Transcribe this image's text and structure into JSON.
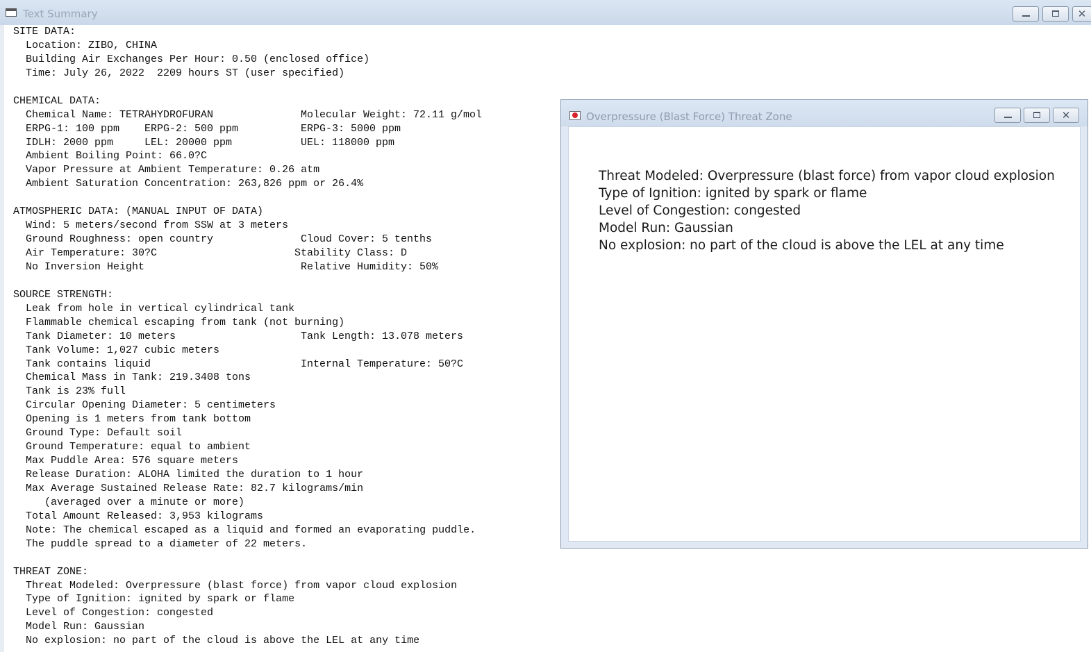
{
  "main_window": {
    "title": "Text Summary",
    "lines": [
      [
        "SITE DATA:",
        ""
      ],
      [
        "  Location: ZIBO, CHINA",
        ""
      ],
      [
        "  Building Air Exchanges Per Hour: 0.50 (enclosed office)",
        ""
      ],
      [
        "  Time: July 26, 2022  2209 hours ST (user specified)",
        ""
      ],
      [
        "",
        ""
      ],
      [
        "CHEMICAL DATA:",
        ""
      ],
      [
        "  Chemical Name: TETRAHYDROFURAN",
        "Molecular Weight: 72.11 g/mol"
      ],
      [
        "  ERPG-1: 100 ppm    ERPG-2: 500 ppm",
        "ERPG-3: 5000 ppm"
      ],
      [
        "  IDLH: 2000 ppm     LEL: 20000 ppm",
        "UEL: 118000 ppm"
      ],
      [
        "  Ambient Boiling Point: 66.0?C",
        ""
      ],
      [
        "  Vapor Pressure at Ambient Temperature: 0.26 atm",
        ""
      ],
      [
        "  Ambient Saturation Concentration: 263,826 ppm or 26.4%",
        ""
      ],
      [
        "",
        ""
      ],
      [
        "ATMOSPHERIC DATA: (MANUAL INPUT OF DATA)",
        ""
      ],
      [
        "  Wind: 5 meters/second from SSW at 3 meters",
        ""
      ],
      [
        "  Ground Roughness: open country",
        "Cloud Cover: 5 tenths"
      ],
      [
        "  Air Temperature: 30?C",
        "Stability Class: D"
      ],
      [
        "  No Inversion Height",
        "Relative Humidity: 50%"
      ],
      [
        "",
        ""
      ],
      [
        "SOURCE STRENGTH:",
        ""
      ],
      [
        "  Leak from hole in vertical cylindrical tank",
        ""
      ],
      [
        "  Flammable chemical escaping from tank (not burning)",
        ""
      ],
      [
        "  Tank Diameter: 10 meters",
        "Tank Length: 13.078 meters"
      ],
      [
        "  Tank Volume: 1,027 cubic meters",
        ""
      ],
      [
        "  Tank contains liquid",
        "Internal Temperature: 50?C"
      ],
      [
        "  Chemical Mass in Tank: 219.3408 tons",
        ""
      ],
      [
        "  Tank is 23% full",
        ""
      ],
      [
        "  Circular Opening Diameter: 5 centimeters",
        ""
      ],
      [
        "  Opening is 1 meters from tank bottom",
        ""
      ],
      [
        "  Ground Type: Default soil",
        ""
      ],
      [
        "  Ground Temperature: equal to ambient",
        ""
      ],
      [
        "  Max Puddle Area: 576 square meters",
        ""
      ],
      [
        "  Release Duration: ALOHA limited the duration to 1 hour",
        ""
      ],
      [
        "  Max Average Sustained Release Rate: 82.7 kilograms/min",
        ""
      ],
      [
        "     (averaged over a minute or more)",
        ""
      ],
      [
        "  Total Amount Released: 3,953 kilograms",
        ""
      ],
      [
        "  Note: The chemical escaped as a liquid and formed an evaporating puddle.",
        ""
      ],
      [
        "  The puddle spread to a diameter of 22 meters.",
        ""
      ],
      [
        "",
        ""
      ],
      [
        "THREAT ZONE:",
        ""
      ],
      [
        "  Threat Modeled: Overpressure (blast force) from vapor cloud explosion",
        ""
      ],
      [
        "  Type of Ignition: ignited by spark or flame",
        ""
      ],
      [
        "  Level of Congestion: congested",
        ""
      ],
      [
        "  Model Run: Gaussian",
        ""
      ],
      [
        "  No explosion: no part of the cloud is above the LEL at any time",
        ""
      ]
    ]
  },
  "threat_window": {
    "title": "Overpressure (Blast Force) Threat Zone",
    "lines": [
      "Threat Modeled: Overpressure (blast force) from vapor cloud explosion",
      "Type of Ignition: ignited by spark or flame",
      "Level of Congestion: congested",
      "Model Run: Gaussian",
      "No explosion: no part of the cloud is above the LEL at any time"
    ]
  },
  "icons": {
    "main_app": "text-window-icon",
    "child_app": "aloha-threat-icon",
    "minimize": "minimize-icon",
    "maximize": "maximize-icon",
    "close": "close-icon"
  }
}
